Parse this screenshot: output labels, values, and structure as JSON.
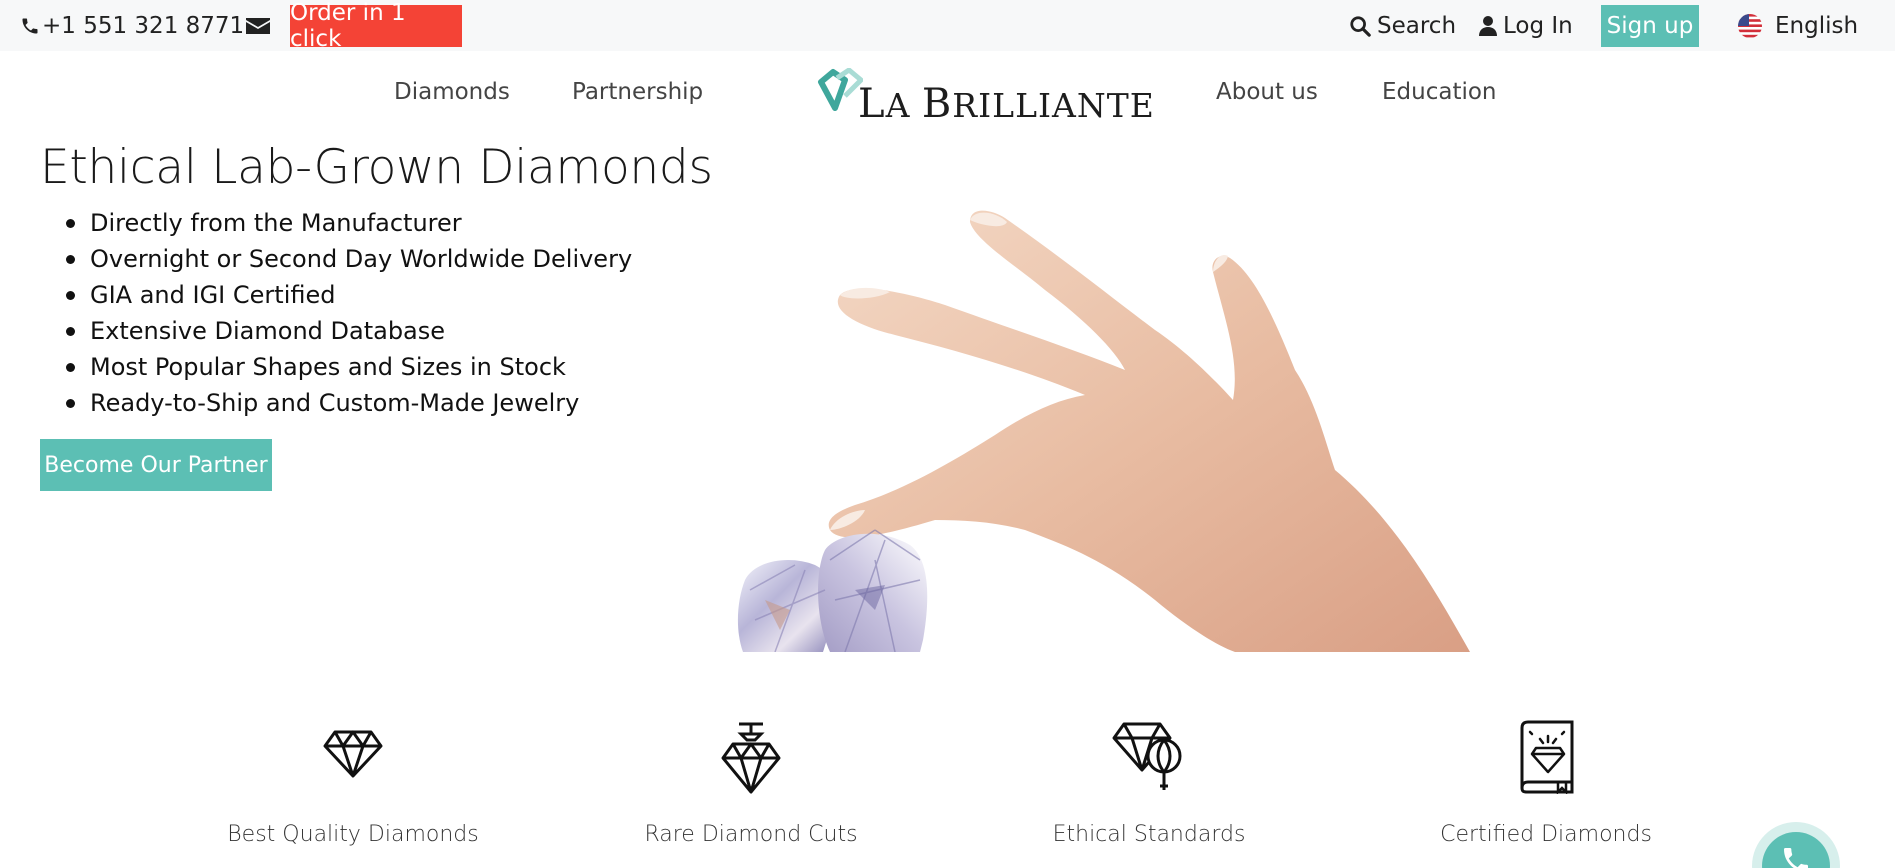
{
  "topbar": {
    "phone": "+1 551 321 8771",
    "phone_icon": "phone-icon",
    "email_icon": "envelope-icon",
    "order_label": "Order in 1 click",
    "search_label": "Search",
    "search_icon": "search-icon",
    "login_label": "Log In",
    "login_icon": "user-icon",
    "signup_label": "Sign up",
    "language_label": "English",
    "language_icon": "us-flag-icon"
  },
  "nav": {
    "items": [
      {
        "label": "Diamonds"
      },
      {
        "label": "Partnership"
      },
      {
        "label": "About us"
      },
      {
        "label": "Education"
      }
    ],
    "logo_text_first": "L",
    "logo_text_a": "A ",
    "logo_text_second": "B",
    "logo_text_rest": "RILLIANTE"
  },
  "hero": {
    "title": "Ethical Lab-Grown Diamonds",
    "features": [
      "Directly from the Manufacturer",
      "Overnight or Second Day Worldwide Delivery",
      "GIA and IGI Certified",
      "Extensive Diamond Database",
      "Most Popular Shapes and Sizes in Stock",
      "Ready-to-Ship and Custom-Made Jewelry"
    ],
    "cta_label": "Become Our Partner"
  },
  "benefits": [
    {
      "label": "Best Quality Diamonds",
      "icon": "diamond-icon"
    },
    {
      "label": "Rare Diamond Cuts",
      "icon": "diamond-cut-icon"
    },
    {
      "label": "Ethical Standards",
      "icon": "ethical-diamond-icon"
    },
    {
      "label": "Certified Diamonds",
      "icon": "certificate-book-icon"
    }
  ],
  "colors": {
    "accent": "#5cbfb4",
    "order_red": "#f44336",
    "topbar_bg": "#f7f8f9"
  }
}
